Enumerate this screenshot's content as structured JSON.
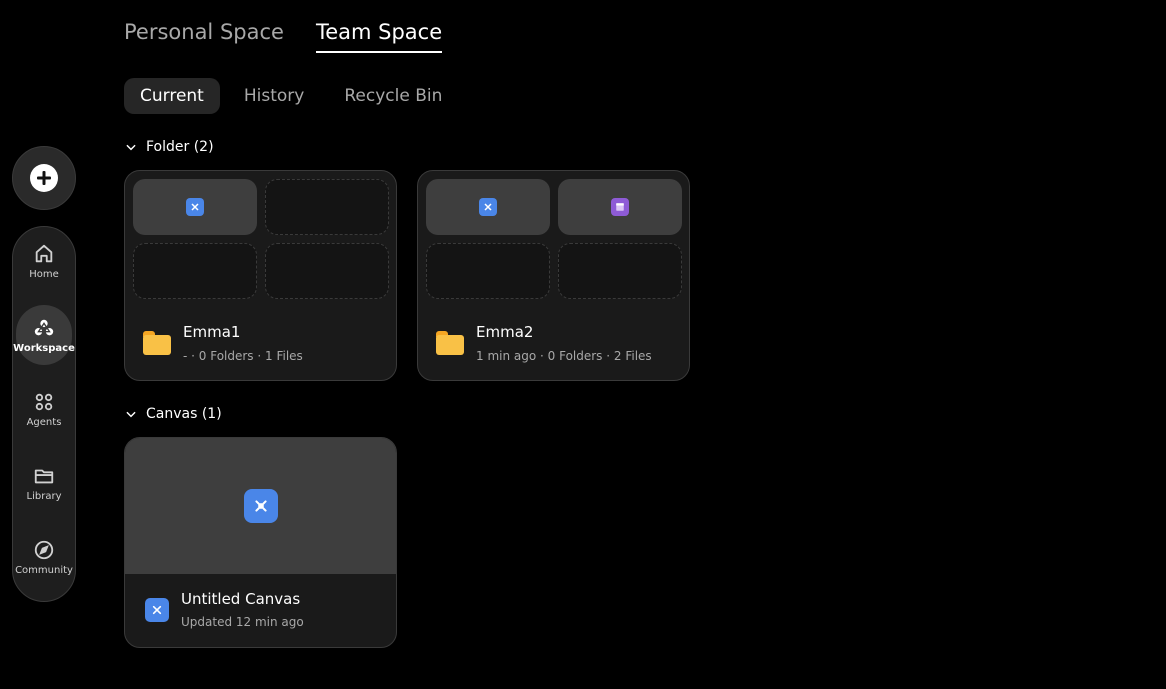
{
  "sidebar": {
    "add_icon": "plus-circle-icon",
    "items": [
      {
        "label": "Home",
        "icon": "home-icon",
        "active": false
      },
      {
        "label": "Workspace",
        "icon": "workspace-icon",
        "active": true
      },
      {
        "label": "Agents",
        "icon": "agents-grid-icon",
        "active": false
      },
      {
        "label": "Library",
        "icon": "folder-icon",
        "active": false
      },
      {
        "label": "Community",
        "icon": "compass-icon",
        "active": false
      }
    ]
  },
  "space_tabs": [
    {
      "label": "Personal Space",
      "active": false
    },
    {
      "label": "Team Space",
      "active": true
    }
  ],
  "sub_tabs": [
    {
      "label": "Current",
      "active": true
    },
    {
      "label": "History",
      "active": false
    },
    {
      "label": "Recycle Bin",
      "active": false
    }
  ],
  "folders_section": {
    "label": "Folder (2)",
    "items": [
      {
        "name": "Emma1",
        "meta": "- · 0 Folders · 1 Files",
        "previews": [
          "canvas",
          "",
          "",
          ""
        ]
      },
      {
        "name": "Emma2",
        "meta": "1 min ago · 0 Folders · 2 Files",
        "previews": [
          "canvas",
          "doc",
          "",
          ""
        ]
      }
    ]
  },
  "canvas_section": {
    "label": "Canvas (1)",
    "items": [
      {
        "name": "Untitled Canvas",
        "meta": "Updated 12 min ago"
      }
    ]
  },
  "colors": {
    "background": "#000000",
    "card": "#1a1a1a",
    "canvas_icon": "#4a86e8",
    "doc_icon": "#8e5bd6",
    "folder": "#f9c146"
  }
}
